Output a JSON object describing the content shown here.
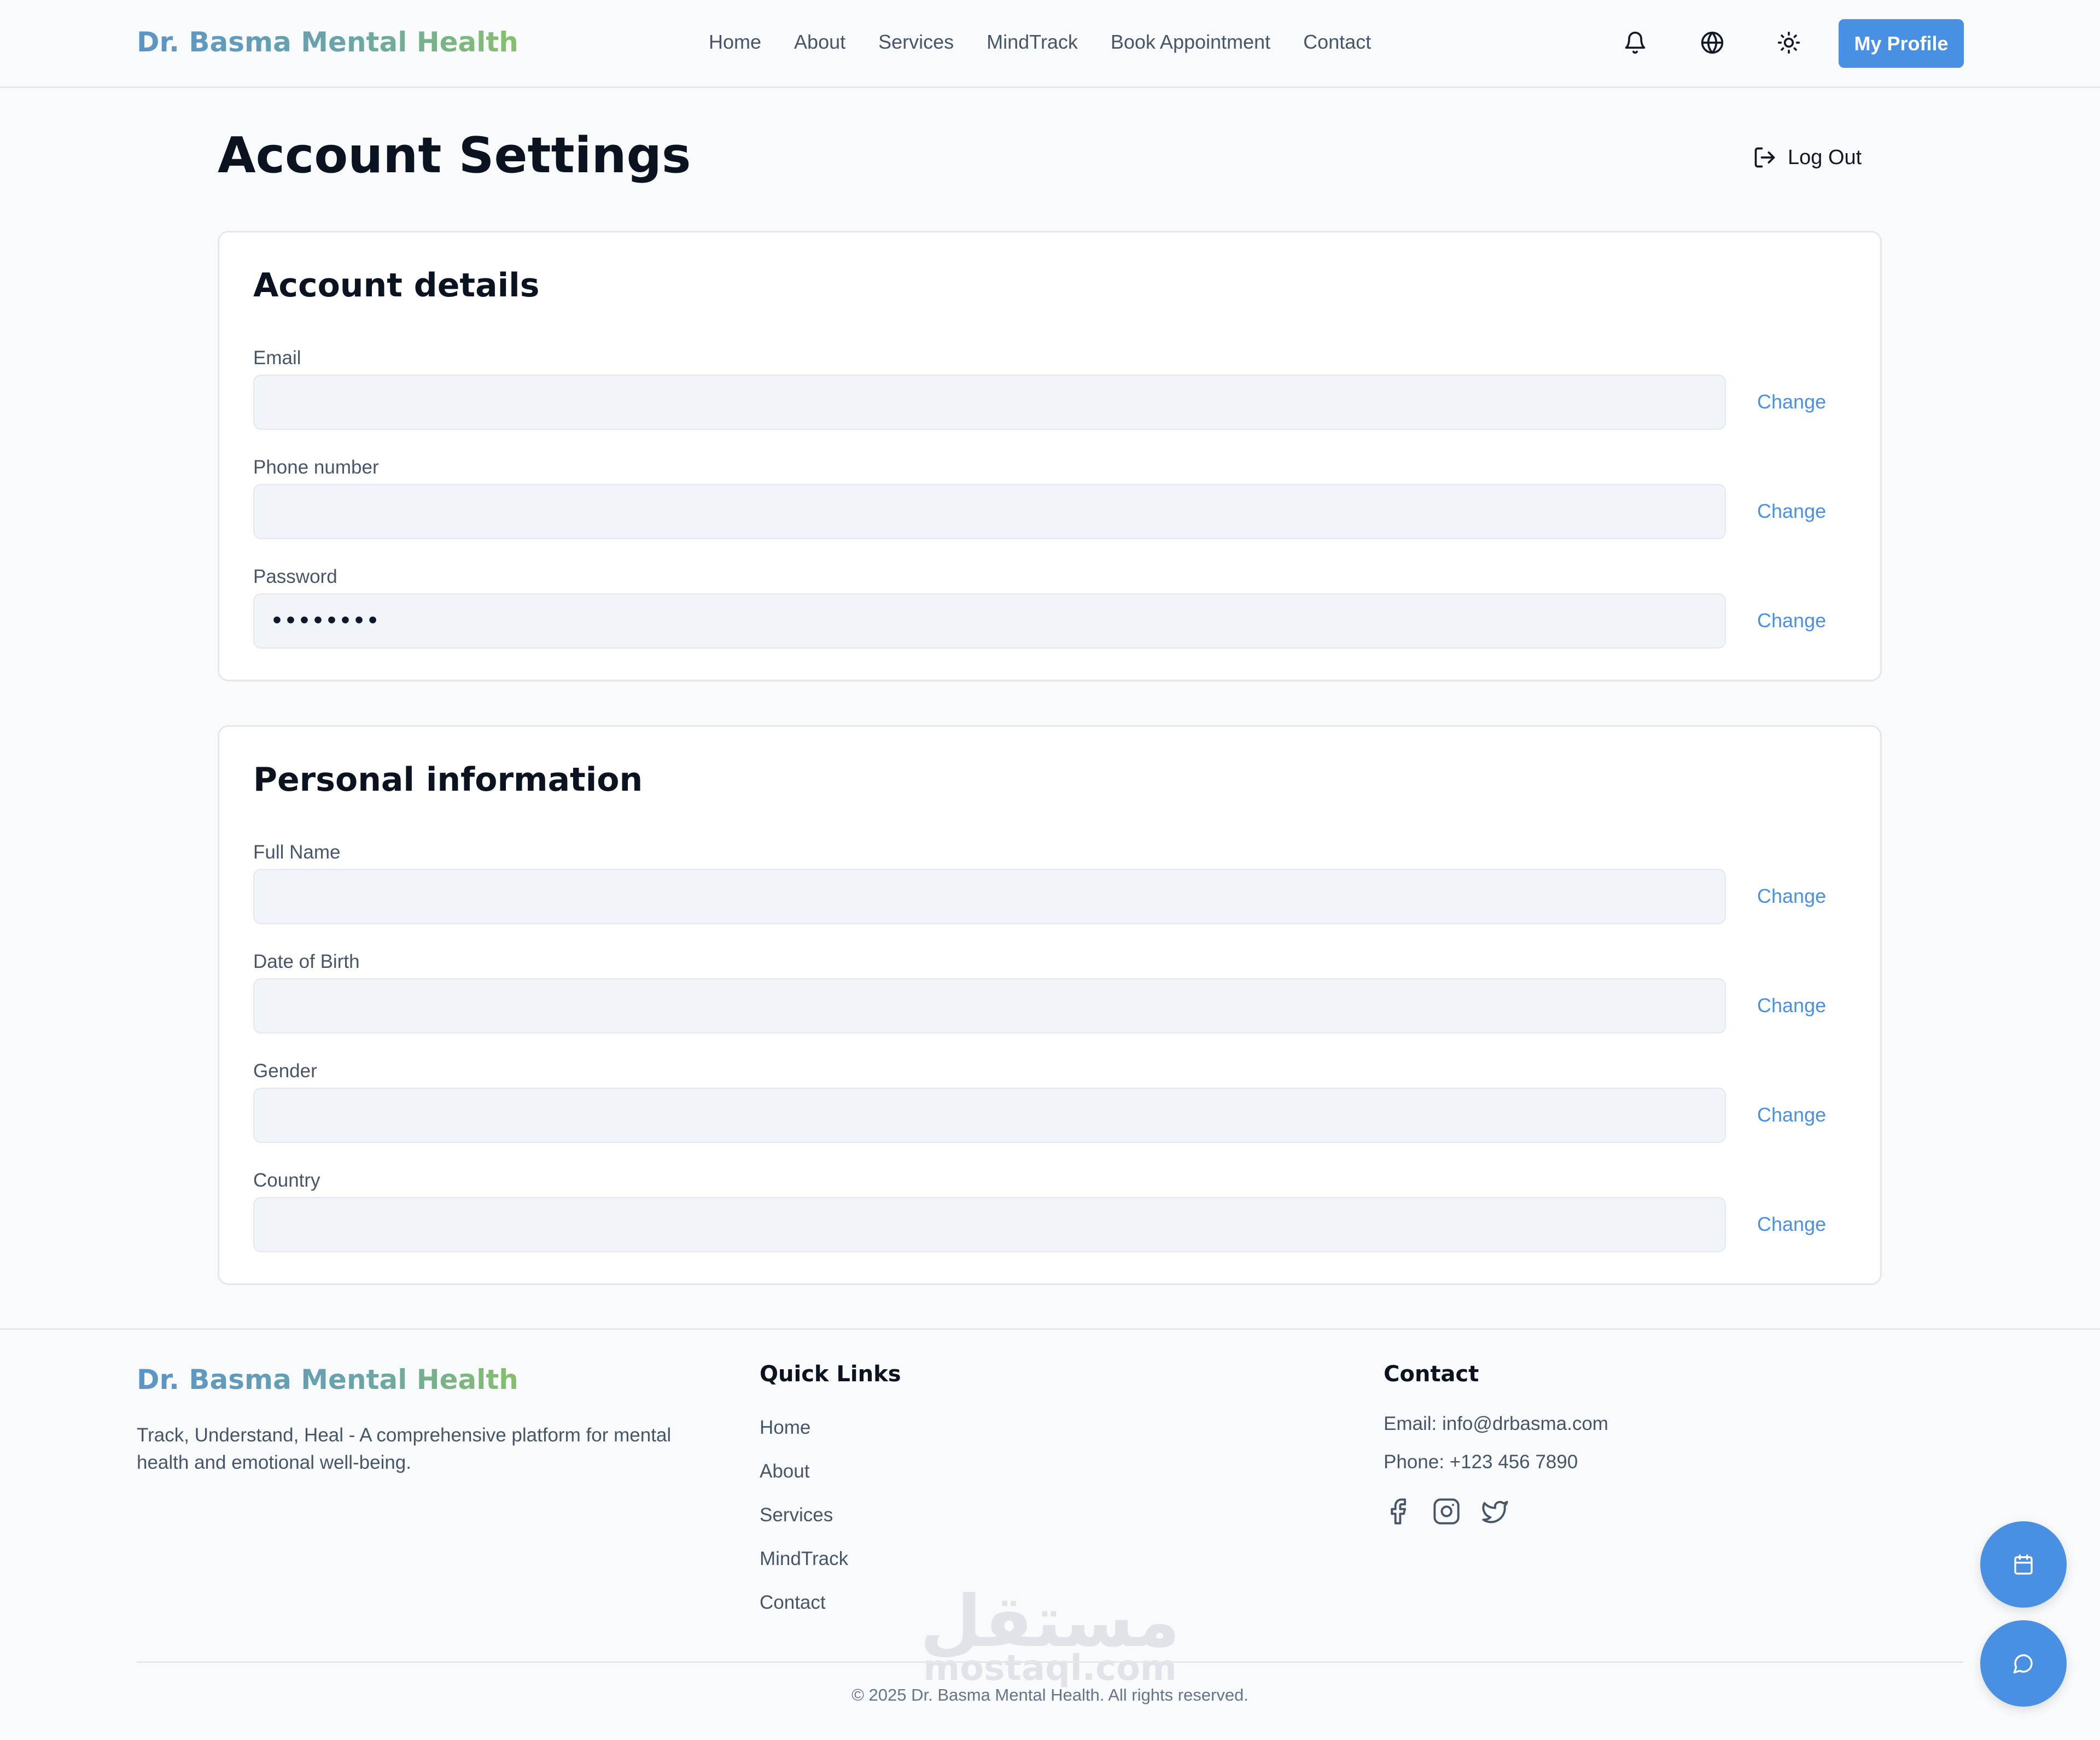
{
  "header": {
    "logo": "Dr. Basma Mental Health",
    "nav": [
      "Home",
      "About",
      "Services",
      "MindTrack",
      "Book Appointment",
      "Contact"
    ],
    "icons": [
      "bell-icon",
      "globe-icon",
      "sun-icon"
    ],
    "profile_button": "My Profile"
  },
  "page": {
    "title": "Account Settings",
    "logout_label": "Log Out"
  },
  "account_details": {
    "title": "Account details",
    "fields": [
      {
        "label": "Email",
        "value": "",
        "action": "Change"
      },
      {
        "label": "Phone number",
        "value": "",
        "action": "Change"
      },
      {
        "label": "Password",
        "value": "••••••••",
        "action": "Change"
      }
    ]
  },
  "personal_info": {
    "title": "Personal information",
    "fields": [
      {
        "label": "Full Name",
        "value": "",
        "action": "Change"
      },
      {
        "label": "Date of Birth",
        "value": "",
        "action": "Change"
      },
      {
        "label": "Gender",
        "value": "",
        "action": "Change"
      },
      {
        "label": "Country",
        "value": "",
        "action": "Change"
      }
    ]
  },
  "footer": {
    "logo": "Dr. Basma Mental Health",
    "tagline": "Track, Understand, Heal - A comprehensive platform for mental health and emotional well-being.",
    "quick_links_title": "Quick Links",
    "quick_links": [
      "Home",
      "About",
      "Services",
      "MindTrack",
      "Contact"
    ],
    "contact_title": "Contact",
    "email": "Email: info@drbasma.com",
    "phone": "Phone: +123 456 7890",
    "social_icons": [
      "facebook-icon",
      "instagram-icon",
      "twitter-icon"
    ],
    "copyright": "© 2025 Dr. Basma Mental Health. All rights reserved."
  },
  "watermark": {
    "arabic": "مستقل",
    "latin": "mostaql.com"
  },
  "fabs": [
    "calendar-icon",
    "chat-icon"
  ],
  "colors": {
    "accent": "#4a90e2",
    "logo_start": "#5b94c8",
    "logo_end": "#86c06a",
    "input_bg": "#f1f5f9"
  }
}
